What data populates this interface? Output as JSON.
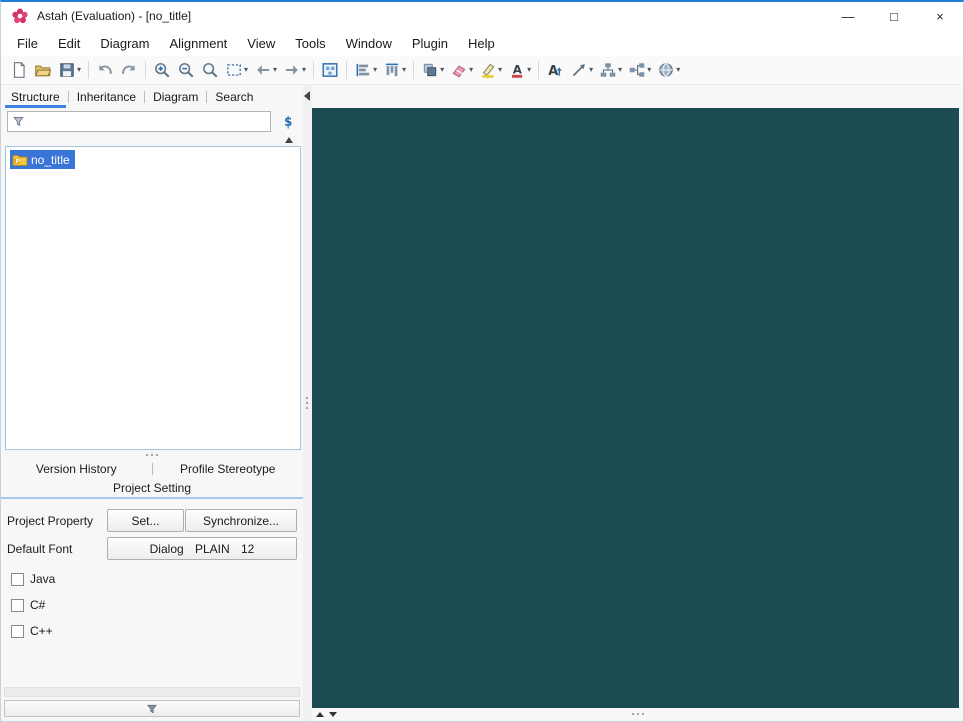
{
  "window": {
    "title": "Astah (Evaluation) - [no_title]",
    "controls": {
      "minimize": "—",
      "maximize": "□",
      "close": "×"
    }
  },
  "menu": {
    "items": [
      "File",
      "Edit",
      "Diagram",
      "Alignment",
      "View",
      "Tools",
      "Window",
      "Plugin",
      "Help"
    ]
  },
  "toolbar": {
    "icons": [
      "new-file",
      "open-project",
      "save",
      "undo",
      "redo",
      "zoom-in",
      "zoom-out",
      "zoom-100",
      "zoom-area",
      "previous-diagram",
      "next-diagram",
      "diagram-overview",
      "align",
      "distribute",
      "depth-order",
      "color-fill",
      "highlighter",
      "font-color",
      "font-size",
      "line-shape",
      "hierarchy",
      "auto-layout",
      "community-site"
    ]
  },
  "left_panel": {
    "tabs": [
      "Structure",
      "Inheritance",
      "Diagram",
      "Search"
    ],
    "active_tab": "Structure",
    "filter_placeholder": "",
    "tree": {
      "items": [
        {
          "label": "no_title",
          "selected": true,
          "icon": "package-icon"
        }
      ]
    },
    "bottom_tabs": {
      "row1": [
        "Version History",
        "Profile Stereotype"
      ],
      "row2": [
        "Project Setting"
      ],
      "active": "Project Setting"
    },
    "project_setting": {
      "rows": [
        {
          "label": "Project Property",
          "buttons": [
            "Set...",
            "Synchronize..."
          ]
        },
        {
          "label": "Default Font",
          "buttons": [
            "Dialog PLAIN 12"
          ]
        }
      ],
      "checkboxes": [
        {
          "label": "Java",
          "checked": false
        },
        {
          "label": "C#",
          "checked": false
        },
        {
          "label": "C++",
          "checked": false
        }
      ]
    }
  },
  "colors": {
    "accent_blue": "#3c82e0",
    "selection_blue": "#3875d7",
    "canvas_teal": "#1d4b53",
    "divider_blue": "#a7cbf0"
  }
}
